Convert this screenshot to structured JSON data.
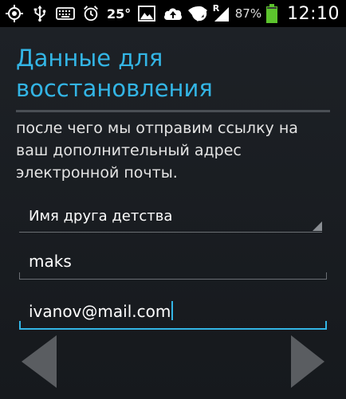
{
  "status_bar": {
    "temperature": "25°",
    "battery_percent": "87%",
    "time": "12:10",
    "network_roaming": "R",
    "icons": [
      "gps-icon",
      "usb-icon",
      "keyboard-icon",
      "alarm-icon",
      "image-icon",
      "cloud-upload-icon",
      "circle-app-icon",
      "wifi-icon",
      "signal-icon",
      "battery-icon"
    ],
    "battery_color": "#5cc42d"
  },
  "screen": {
    "title": "Данные для восстановления",
    "description": "после чего мы отправим ссылку на ваш дополнительный адрес электронной почты.",
    "security_question": "Имя друга детства",
    "answer": "maks",
    "email": "ivanov@mail.com"
  },
  "colors": {
    "accent": "#33b5e5",
    "nav_arrow": "#5a5d61"
  }
}
